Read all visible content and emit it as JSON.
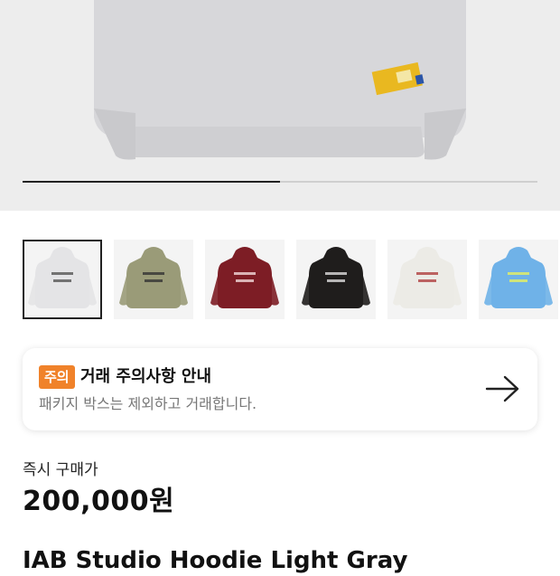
{
  "hero": {
    "image": "light-gray-hoodie-back",
    "image_progress": 0.5
  },
  "thumbnails": [
    {
      "name": "light-gray-hoodie",
      "color": "#e4e4e6",
      "print_color": "#555555",
      "selected": true
    },
    {
      "name": "khaki-hoodie",
      "color": "#9a9b78",
      "print_color": "#333333",
      "selected": false
    },
    {
      "name": "burgundy-hoodie",
      "color": "#7d1d25",
      "print_color": "#f1d9d9",
      "selected": false
    },
    {
      "name": "black-hoodie",
      "color": "#1f1d1c",
      "print_color": "#dddddd",
      "selected": false
    },
    {
      "name": "ivory-hoodie",
      "color": "#ecebe6",
      "print_color": "#b04040",
      "selected": false
    },
    {
      "name": "sky-blue-hoodie",
      "color": "#6fb2e8",
      "print_color": "#e7f060",
      "selected": false
    }
  ],
  "notice": {
    "badge": "주의",
    "title": "거래 주의사항 안내",
    "description": "패키지 박스는 제외하고 거래합니다.",
    "icon": "arrow-right-icon"
  },
  "price": {
    "label": "즉시 구매가",
    "value": "200,000원"
  },
  "product": {
    "title": "IAB Studio Hoodie Light Gray"
  },
  "colors": {
    "badge": "#f0822a",
    "hero_background": "#ededed"
  }
}
